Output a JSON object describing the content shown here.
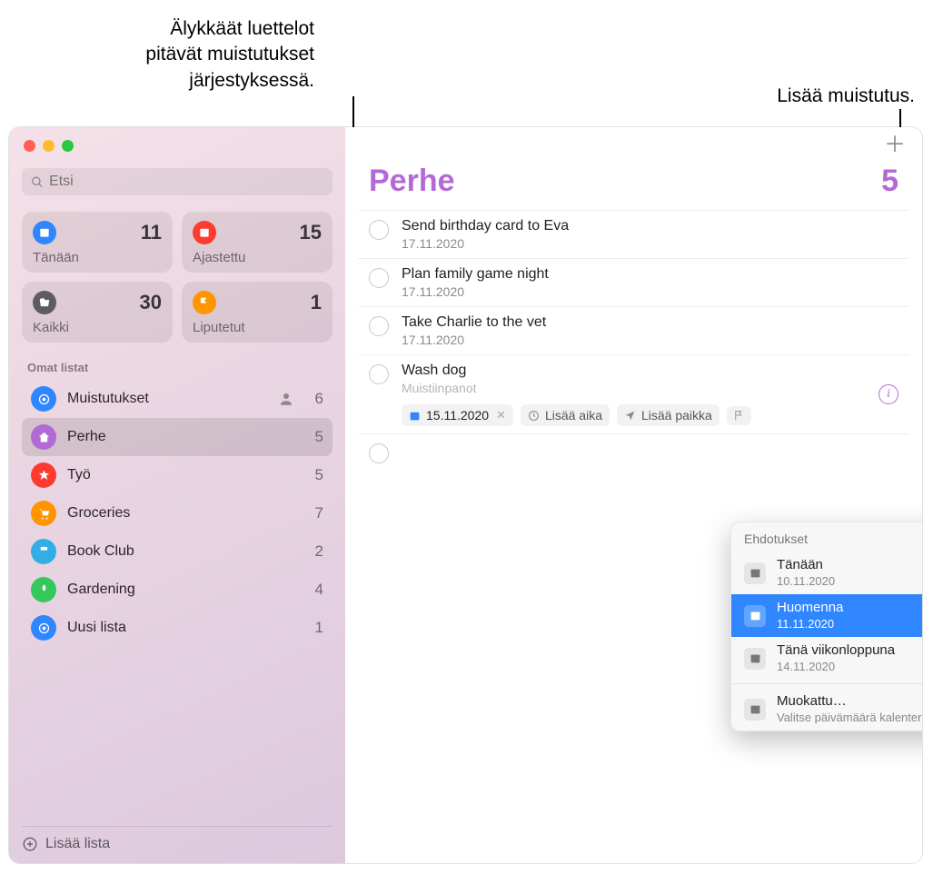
{
  "callouts": {
    "smartlists": "Älykkäät luettelot\npitävät muistutukset\njärjestyksessä.",
    "add": "Lisää muistutus."
  },
  "sidebar": {
    "search_placeholder": "Etsi",
    "smartlists": [
      {
        "label": "Tänään",
        "count": "11",
        "color": "#2f86ff"
      },
      {
        "label": "Ajastettu",
        "count": "15",
        "color": "#ff3b30"
      },
      {
        "label": "Kaikki",
        "count": "30",
        "color": "#5c5c61"
      },
      {
        "label": "Liputetut",
        "count": "1",
        "color": "#ff9500"
      }
    ],
    "section_title": "Omat listat",
    "lists": [
      {
        "name": "Muistutukset",
        "count": "6",
        "color": "#2f86ff",
        "shared": true
      },
      {
        "name": "Perhe",
        "count": "5",
        "color": "#b369d6",
        "selected": true
      },
      {
        "name": "Työ",
        "count": "5",
        "color": "#ff3b30"
      },
      {
        "name": "Groceries",
        "count": "7",
        "color": "#ff9500"
      },
      {
        "name": "Book Club",
        "count": "2",
        "color": "#32ade6"
      },
      {
        "name": "Gardening",
        "count": "4",
        "color": "#34c759"
      },
      {
        "name": "Uusi lista",
        "count": "1",
        "color": "#2f86ff"
      }
    ],
    "add_list": "Lisää lista"
  },
  "main": {
    "title": "Perhe",
    "count": "5",
    "accent": "#b369d6",
    "reminders": [
      {
        "title": "Send birthday card to Eva",
        "date": "17.11.2020"
      },
      {
        "title": "Plan family game night",
        "date": "17.11.2020"
      },
      {
        "title": "Take Charlie to the vet",
        "date": "17.11.2020"
      },
      {
        "title": "Wash dog",
        "notes": "Muistiinpanot",
        "editing": true
      }
    ],
    "chips": {
      "date": "15.11.2020",
      "time": "Lisää aika",
      "location": "Lisää paikka"
    }
  },
  "popover": {
    "title": "Ehdotukset",
    "items": [
      {
        "label": "Tänään",
        "sub": "10.11.2020"
      },
      {
        "label": "Huomenna",
        "sub": "11.11.2020",
        "highlight": true
      },
      {
        "label": "Tänä viikonloppuna",
        "sub": "14.11.2020"
      }
    ],
    "custom": {
      "label": "Muokattu…",
      "sub": "Valitse päivämäärä kalenterista"
    }
  }
}
